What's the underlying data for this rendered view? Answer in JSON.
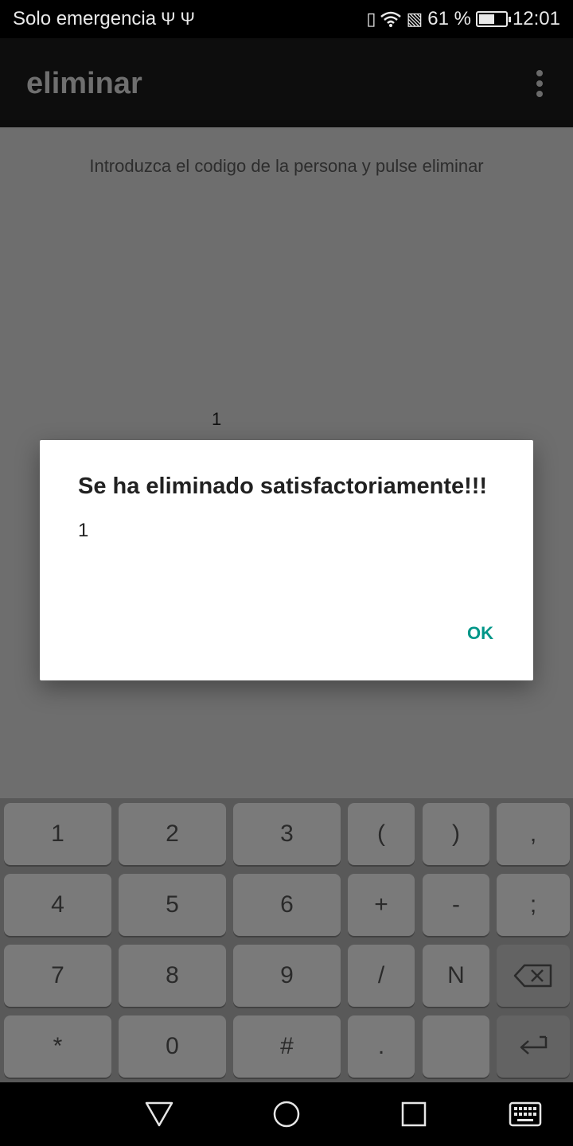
{
  "status_bar": {
    "carrier_text": "Solo emergencia",
    "battery_text": "61 %",
    "battery_level": 0.61,
    "time": "12:01",
    "icons": [
      "usb-icon",
      "usb-icon",
      "vibrate-icon",
      "wifi-icon",
      "sim-alert-icon",
      "battery-charging-icon"
    ]
  },
  "app_bar": {
    "title": "eliminar",
    "menu_icon": "overflow-menu-icon"
  },
  "content": {
    "instruction": "Introduzca el codigo de la persona y pulse eliminar",
    "code_value": "1"
  },
  "dialog": {
    "title": "Se ha eliminado satisfactoriamente!!!",
    "message": "1",
    "ok_label": "OK",
    "accent_color": "#009688"
  },
  "keyboard": {
    "rows": [
      [
        "1",
        "2",
        "3",
        "(",
        ")",
        ","
      ],
      [
        "4",
        "5",
        "6",
        "+",
        "-",
        ";"
      ],
      [
        "7",
        "8",
        "9",
        "/",
        "N",
        "backspace-icon"
      ],
      [
        "*",
        "0",
        "#",
        ".",
        "",
        "enter-icon"
      ]
    ]
  },
  "nav_bar": {
    "icons": [
      "back-icon",
      "home-icon",
      "recents-icon",
      "keyboard-icon"
    ]
  }
}
